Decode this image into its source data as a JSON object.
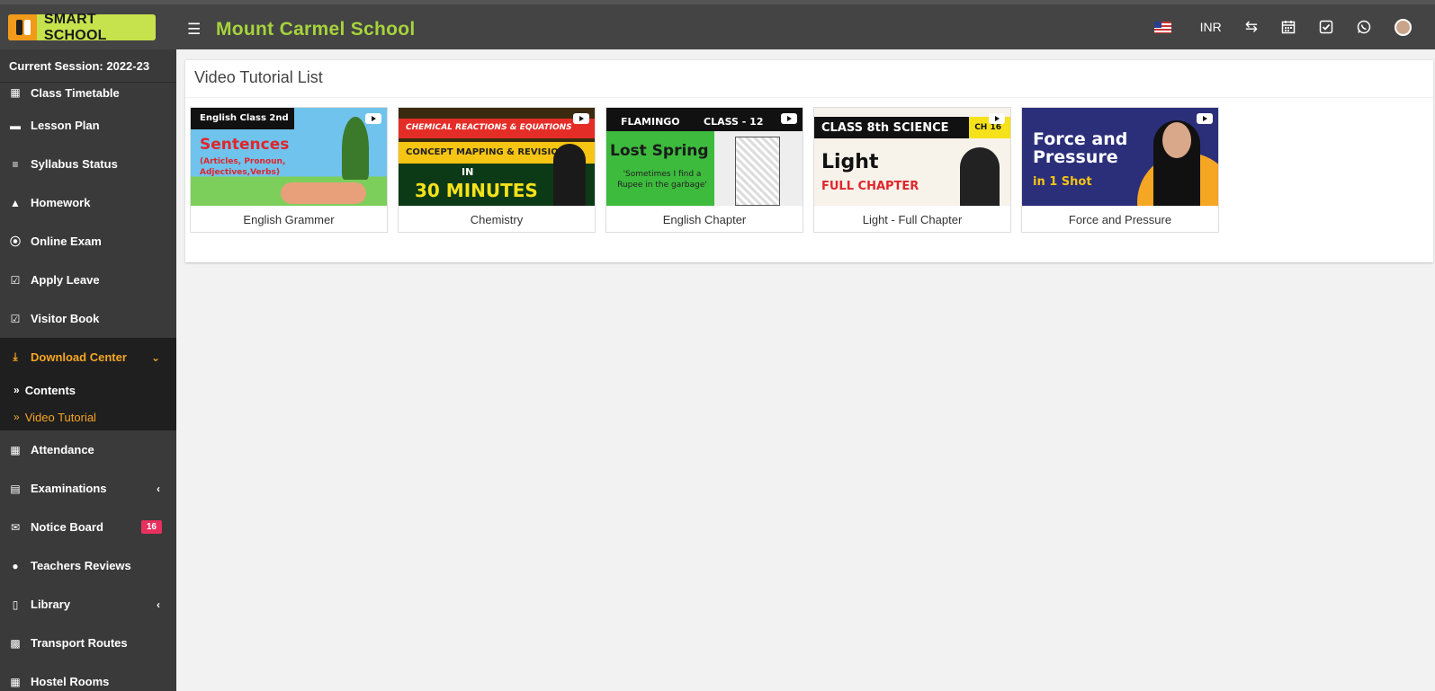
{
  "header": {
    "logo_text": "SMART SCHOOL",
    "school_name": "Mount Carmel School",
    "currency": "INR",
    "icons": [
      "menu-icon",
      "flag-us-icon",
      "exchange-icon",
      "calendar-icon",
      "check-square-icon",
      "whatsapp-icon",
      "user-avatar"
    ]
  },
  "sidebar": {
    "session": "Current Session: 2022-23",
    "items": [
      {
        "label": "Class Timetable",
        "icon": "calendar-plus-icon"
      },
      {
        "label": "Lesson Plan",
        "icon": "keyboard-icon"
      },
      {
        "label": "Syllabus Status",
        "icon": "list-icon"
      },
      {
        "label": "Homework",
        "icon": "flask-icon"
      },
      {
        "label": "Online Exam",
        "icon": "rss-icon"
      },
      {
        "label": "Apply Leave",
        "icon": "check-square-icon"
      },
      {
        "label": "Visitor Book",
        "icon": "check-square-icon"
      },
      {
        "label": "Download Center",
        "icon": "download-icon"
      },
      {
        "label": "Attendance",
        "icon": "calendar-check-icon"
      },
      {
        "label": "Examinations",
        "icon": "map-icon"
      },
      {
        "label": "Notice Board",
        "icon": "envelope-icon",
        "badge": "16"
      },
      {
        "label": "Teachers Reviews",
        "icon": "user-secret-icon"
      },
      {
        "label": "Library",
        "icon": "book-icon"
      },
      {
        "label": "Transport Routes",
        "icon": "bus-icon"
      },
      {
        "label": "Hostel Rooms",
        "icon": "building-icon"
      }
    ],
    "download_sub": [
      {
        "label": "Contents"
      },
      {
        "label": "Video Tutorial"
      }
    ]
  },
  "main": {
    "title": "Video Tutorial List",
    "videos": [
      {
        "label": "English Grammer",
        "thumb_lines": [
          "English Class 2nd",
          "Sentences",
          "(Articles, Pronoun, Adjectives,Verbs)"
        ]
      },
      {
        "label": "Chemistry",
        "thumb_lines": [
          "CHEMICAL REACTIONS & EQUATIONS",
          "CONCEPT MAPPING & REVISION",
          "IN",
          "30 MINUTES"
        ]
      },
      {
        "label": "English Chapter",
        "thumb_lines": [
          "FLAMINGO",
          "CLASS - 12",
          "Lost Spring",
          "'Sometimes I find a Rupee in the garbage'"
        ]
      },
      {
        "label": "Light - Full Chapter",
        "thumb_lines": [
          "CLASS 8th SCIENCE",
          "CH 16",
          "Light",
          "FULL CHAPTER"
        ]
      },
      {
        "label": "Force and Pressure",
        "thumb_lines": [
          "Force and",
          "Pressure",
          "in 1 Shot"
        ]
      }
    ]
  }
}
